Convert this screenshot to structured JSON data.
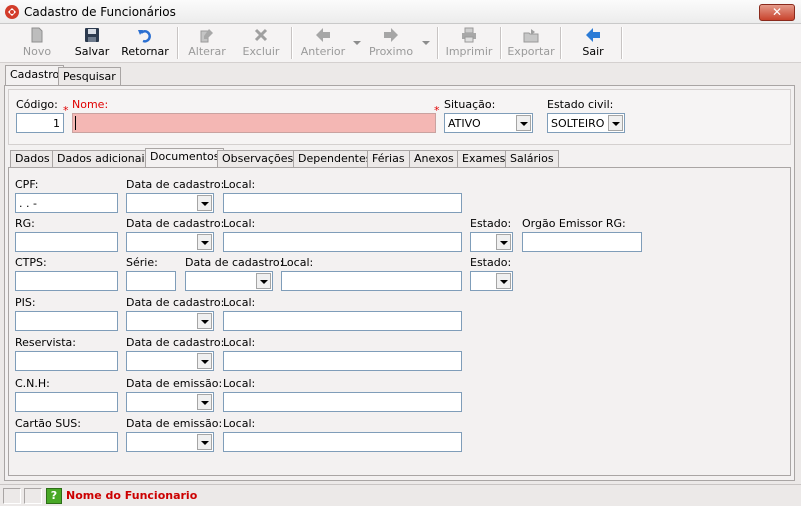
{
  "window": {
    "title": "Cadastro de Funcionários",
    "close_label": "✕"
  },
  "toolbar": {
    "novo": "Novo",
    "salvar": "Salvar",
    "retornar": "Retornar",
    "alterar": "Alterar",
    "excluir": "Excluir",
    "anterior": "Anterior",
    "proximo": "Proximo",
    "imprimir": "Imprimir",
    "exportar": "Exportar",
    "sair": "Sair"
  },
  "top_tabs": {
    "cadastro": "Cadastro",
    "pesquisar": "Pesquisar"
  },
  "header": {
    "codigo_label": "Código:",
    "codigo_value": "1",
    "nome_label": "Nome:",
    "nome_value": "",
    "situacao_label": "Situação:",
    "situacao_value": "ATIVO",
    "estado_civil_label": "Estado civil:",
    "estado_civil_value": "SOLTEIRO",
    "required_mark": "*"
  },
  "inner_tabs": [
    "Dados",
    "Dados adicionais",
    "Documentos",
    "Observações",
    "Dependentes",
    "Férias",
    "Anexos",
    "Exames",
    "Salários"
  ],
  "documentos": {
    "cpf_label": "CPF:",
    "cpf_value": " .   .   -",
    "data_cadastro_label": "Data de cadastro:",
    "data_emissao_label": "Data de emissão:",
    "local_label": "Local:",
    "rg_label": "RG:",
    "estado_label": "Estado:",
    "orgao_label": "Orgão Emissor RG:",
    "ctps_label": "CTPS:",
    "serie_label": "Série:",
    "pis_label": "PIS:",
    "reservista_label": "Reservista:",
    "cnh_label": "C.N.H:",
    "cartao_sus_label": "Cartão SUS:"
  },
  "status": {
    "text": "Nome do Funcionario",
    "help": "?"
  },
  "colors": {
    "required": "#e00000",
    "name_field_bg": "#f4b7b4",
    "status_text": "#cc0000",
    "help_green": "#49a827"
  }
}
